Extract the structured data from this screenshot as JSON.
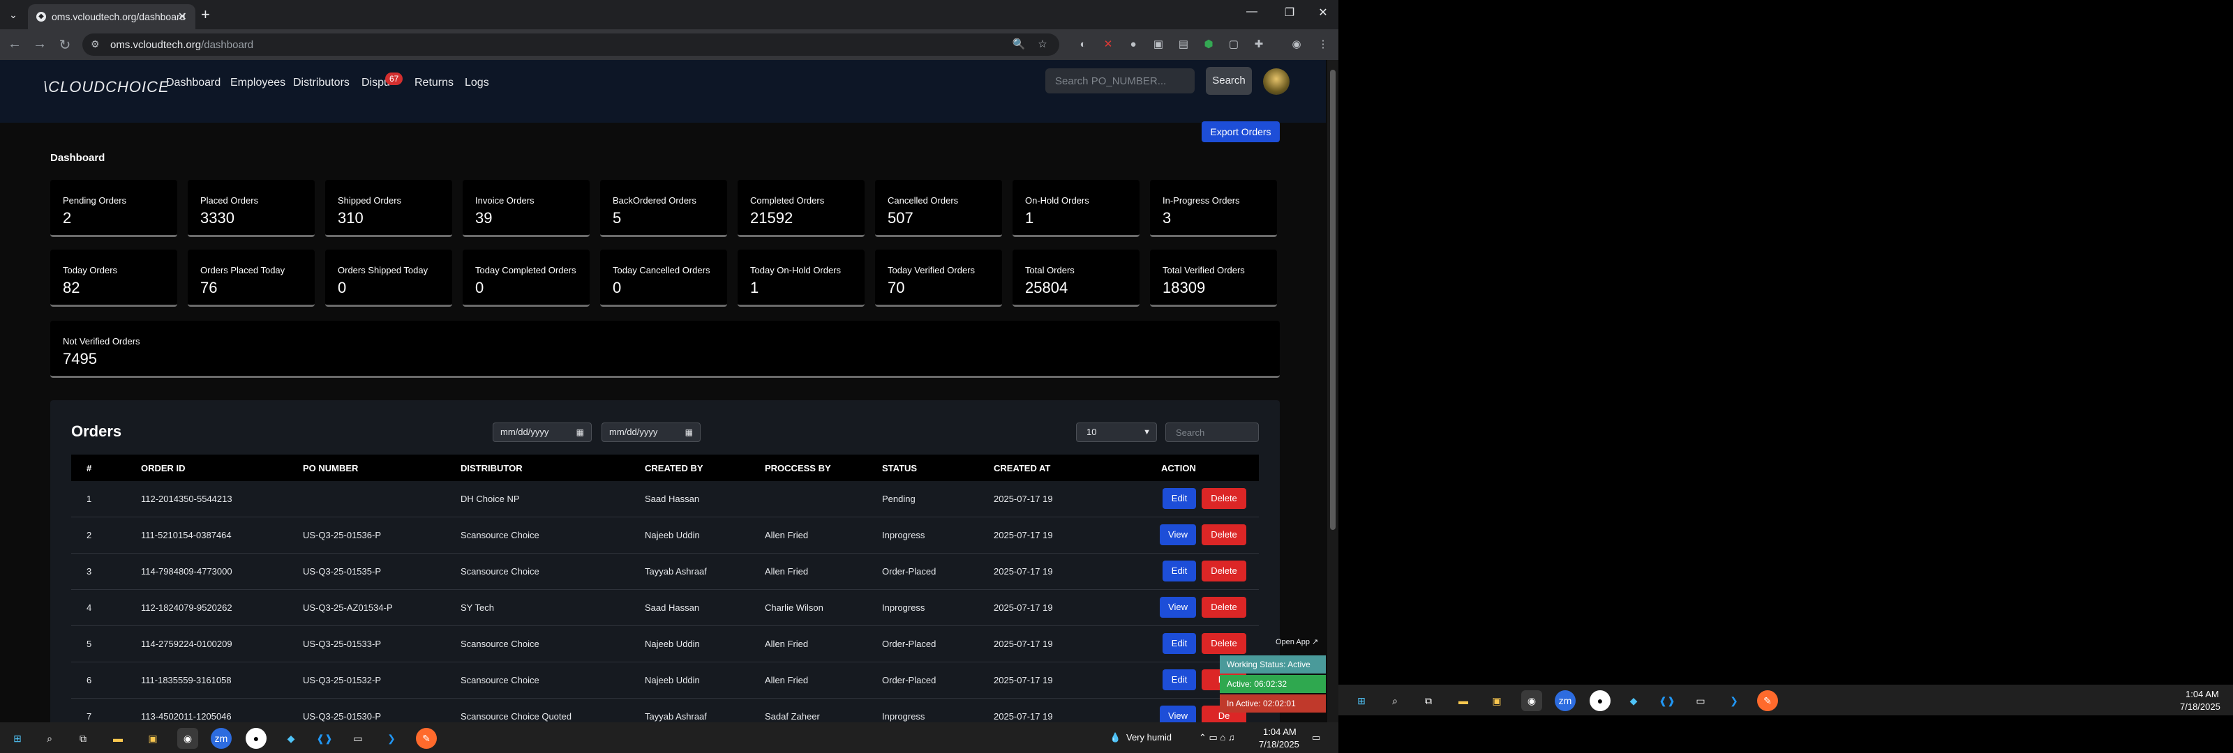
{
  "browser": {
    "tab_title": "oms.vcloudtech.org/dashboard",
    "url_domain": "oms.vcloudtech.org",
    "url_path": "/dashboard"
  },
  "site": {
    "logo": "\\CLOUDCHOICE",
    "nav": [
      "Dashboard",
      "Employees",
      "Distributors",
      "Dispu",
      "Returns",
      "Logs"
    ],
    "dispute_count": "67",
    "search_placeholder": "Search PO_NUMBER...",
    "search_label": "Search"
  },
  "dashboard": {
    "title": "Dashboard",
    "export_label": "Export Orders",
    "stats_row1": [
      {
        "label": "Pending Orders",
        "value": "2"
      },
      {
        "label": "Placed Orders",
        "value": "3330"
      },
      {
        "label": "Shipped Orders",
        "value": "310"
      },
      {
        "label": "Invoice Orders",
        "value": "39"
      },
      {
        "label": "BackOrdered Orders",
        "value": "5"
      },
      {
        "label": "Completed Orders",
        "value": "21592"
      },
      {
        "label": "Cancelled Orders",
        "value": "507"
      },
      {
        "label": "On-Hold Orders",
        "value": "1"
      },
      {
        "label": "In-Progress Orders",
        "value": "3"
      }
    ],
    "stats_row2": [
      {
        "label": "Today Orders",
        "value": "82"
      },
      {
        "label": "Orders Placed Today",
        "value": "76"
      },
      {
        "label": "Orders Shipped Today",
        "value": "0"
      },
      {
        "label": "Today Completed Orders",
        "value": "0"
      },
      {
        "label": "Today Cancelled Orders",
        "value": "0"
      },
      {
        "label": "Today On-Hold Orders",
        "value": "1"
      },
      {
        "label": "Today Verified Orders",
        "value": "70"
      },
      {
        "label": "Total Orders",
        "value": "25804"
      },
      {
        "label": "Total Verified Orders",
        "value": "18309"
      }
    ],
    "not_verified": {
      "label": "Not Verified Orders",
      "value": "7495"
    }
  },
  "orders": {
    "title": "Orders",
    "date_placeholder": "mm/dd/yyyy",
    "page_size": "10",
    "search_placeholder": "Search",
    "headers": [
      "#",
      "ORDER ID",
      "PO NUMBER",
      "DISTRIBUTOR",
      "CREATED BY",
      "PROCCESS BY",
      "STATUS",
      "CREATED AT",
      "ACTION"
    ],
    "rows": [
      {
        "n": "1",
        "order_id": "112-2014350-5544213",
        "po": "",
        "distributor": "DH Choice NP",
        "created_by": "Saad Hassan",
        "process_by": "",
        "status": "Pending",
        "created_at": "2025-07-17 19",
        "primary": "Edit",
        "delete": "Delete"
      },
      {
        "n": "2",
        "order_id": "111-5210154-0387464",
        "po": "US-Q3-25-01536-P",
        "distributor": "Scansource Choice",
        "created_by": "Najeeb Uddin",
        "process_by": "Allen Fried",
        "status": "Inprogress",
        "created_at": "2025-07-17 19",
        "primary": "View",
        "delete": "Delete"
      },
      {
        "n": "3",
        "order_id": "114-7984809-4773000",
        "po": "US-Q3-25-01535-P",
        "distributor": "Scansource Choice",
        "created_by": "Tayyab Ashraaf",
        "process_by": "Allen Fried",
        "status": "Order-Placed",
        "created_at": "2025-07-17 19",
        "primary": "Edit",
        "delete": "Delete"
      },
      {
        "n": "4",
        "order_id": "112-1824079-9520262",
        "po": "US-Q3-25-AZ01534-P",
        "distributor": "SY Tech",
        "created_by": "Saad Hassan",
        "process_by": "Charlie Wilson",
        "status": "Inprogress",
        "created_at": "2025-07-17 19",
        "primary": "View",
        "delete": "Delete"
      },
      {
        "n": "5",
        "order_id": "114-2759224-0100209",
        "po": "US-Q3-25-01533-P",
        "distributor": "Scansource Choice",
        "created_by": "Najeeb Uddin",
        "process_by": "Allen Fried",
        "status": "Order-Placed",
        "created_at": "2025-07-17 19",
        "primary": "Edit",
        "delete": "Delete"
      },
      {
        "n": "6",
        "order_id": "111-1835559-3161058",
        "po": "US-Q3-25-01532-P",
        "distributor": "Scansource Choice",
        "created_by": "Najeeb Uddin",
        "process_by": "Allen Fried",
        "status": "Order-Placed",
        "created_at": "2025-07-17 19",
        "primary": "Edit",
        "delete": "De"
      },
      {
        "n": "7",
        "order_id": "113-4502011-1205046",
        "po": "US-Q3-25-01530-P",
        "distributor": "Scansource Choice Quoted",
        "created_by": "Tayyab Ashraaf",
        "process_by": "Sadaf Zaheer",
        "status": "Inprogress",
        "created_at": "2025-07-17 19",
        "primary": "View",
        "delete": "De"
      }
    ]
  },
  "widget": {
    "open_app": "Open App ↗",
    "working": "Working Status: Active",
    "active": "Active: 06:02:32",
    "inactive": "In Active: 02:02:01",
    "colors": {
      "working": "#4a9a9a",
      "active": "#2fa84f",
      "inactive": "#c0392b"
    }
  },
  "taskbar": {
    "weather": "Very humid",
    "time": "1:04 AM",
    "date": "7/18/2025"
  }
}
